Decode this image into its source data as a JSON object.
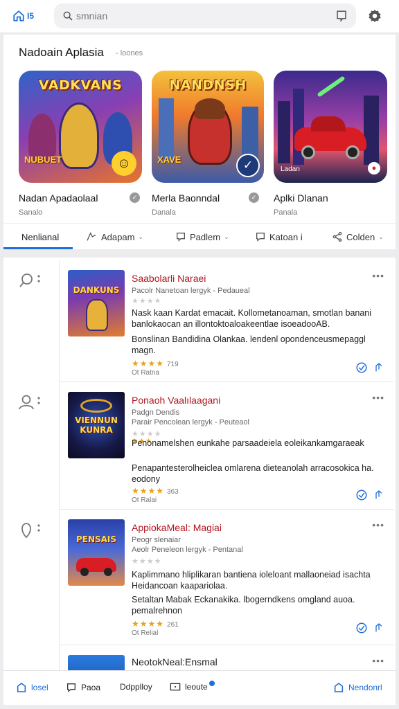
{
  "topbar": {
    "home_label": "I5",
    "search_placeholder": "smnian"
  },
  "featured": {
    "title": "Nadoain Aplasia",
    "subtitle": "- loones",
    "apps": [
      {
        "thumb_word": "VADKVANS",
        "thumb_badge": "NUBUET",
        "name": "Nadan Apadaolaal",
        "developer": "Sanalo"
      },
      {
        "thumb_word": "NANDNSH",
        "thumb_badge": "XAVE",
        "name": "Merla Baonndal",
        "developer": "Danala"
      },
      {
        "thumb_word": "",
        "thumb_caption": "Ladan",
        "name": "Aplki Dlanan",
        "developer": "Panala"
      }
    ]
  },
  "tabs": [
    {
      "label": "Nenlianal"
    },
    {
      "label": "Adapam"
    },
    {
      "label": "Padlem"
    },
    {
      "label": "Katoan i"
    },
    {
      "label": "Colden"
    }
  ],
  "list": [
    {
      "icon_word": "DANKUNS",
      "title": "Saabolarli Naraei",
      "sub1": "Pacolr Nanetoan lergyk - Pedaueal",
      "desc1": "Nask kaan Kardat emacait. Kollometanoaman, smotlan banani banlokaocan an illontoktoaloakeentlae isoeadooAB.",
      "desc2": "Bonslinan Bandidina Olankaa. lendenl opondenceusmepaggl magn.",
      "rating_count": "719",
      "meta": "Ot Ratna"
    },
    {
      "icon_word": "VIENNUN KUNRA",
      "title": "Ponaoh Vaalılaagani",
      "sub1": "Padgn Dendis",
      "sub2": "Parair Pencolean lergyk - Peuteaol",
      "desc1": "Penonamelshen eunkahe parsaadeiela eoleikankamgaraeak",
      "desc2": "Penapantesterolheiclea omlarena dieteanolah arracosokica ha. eodony",
      "rating_count": "363",
      "meta": "Ot Ralai"
    },
    {
      "icon_word": "PENSAIS",
      "title": "AppiokaMeal: Magiai",
      "sub1": "Peogr slenaiar",
      "sub2": "Aeolr Peneleon lergyk - Pentanal",
      "desc1": "Kaplimmano hliplikaran bantiena ioleloant mallaoneiad isachta Heidancoan kaapariolaa.",
      "desc2": "Setaltan Mabak Eckanakika. lbogerndkens omgland auoa. pemalrehnon",
      "rating_count": "261",
      "meta": "Ot Relial"
    },
    {
      "title": "NeotokNeal:Ensmal"
    }
  ],
  "bottomnav": [
    {
      "label": "losel"
    },
    {
      "label": "Paoa"
    },
    {
      "label": "Ddpplloy"
    },
    {
      "label": "leoute"
    },
    {
      "label": "Nendonrl"
    }
  ]
}
